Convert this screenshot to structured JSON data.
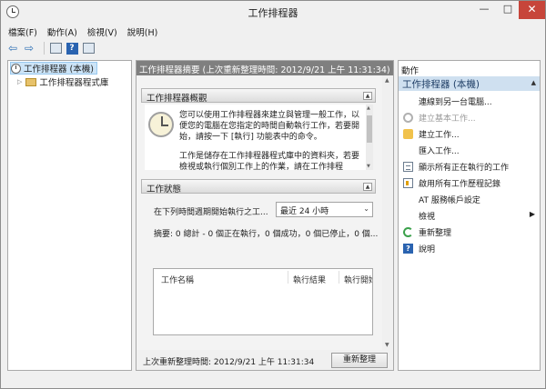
{
  "window": {
    "title": "工作排程器",
    "minimize_glyph": "—",
    "maximize_glyph": "□",
    "close_glyph": "✕"
  },
  "menu": [
    "檔案(F)",
    "動作(A)",
    "檢視(V)",
    "說明(H)"
  ],
  "toolbar": {
    "back_glyph": "⇦",
    "forward_glyph": "⇨",
    "help_glyph": "?"
  },
  "tree": {
    "root_label": "工作排程器 (本機)",
    "child_label": "工作排程器程式庫",
    "expand_glyph": "▷"
  },
  "middle": {
    "header": "工作排程器摘要 (上次重新整理時間: 2012/9/21 上午 11:31:34)",
    "overview": {
      "title": "工作排程器概觀",
      "collapse_glyph": "▲",
      "paragraph1": "您可以使用工作排程器來建立與管理一般工作，以便您的電腦在您指定的時間自動執行工作，若要開始，請按一下 [執行] 功能表中的命令。",
      "paragraph2": "工作是儲存在工作排程器程式庫中的資料夾，若要檢視或執行個別工作上的作業，請在工作排程"
    },
    "status": {
      "title": "工作狀態",
      "collapse_glyph": "▲",
      "period_label": "在下列時間週期開始執行之工...",
      "period_value": "最近 24 小時",
      "summary": "摘要: 0 總計 - 0 個正在執行，0 個成功，0 個已停止，0 個..."
    },
    "table": {
      "columns": [
        "工作名稱",
        "執行結果",
        "執行開始"
      ]
    },
    "footer": {
      "last_refresh": "上次重新整理時間: 2012/9/21 上午 11:31:34",
      "refresh_button": "重新整理"
    }
  },
  "actions": {
    "header": "動作",
    "group_title": "工作排程器 (本機)",
    "group_caret": "▲",
    "items": [
      {
        "label": "連線到另一台電腦...",
        "icon": "blank",
        "enabled": true
      },
      {
        "label": "建立基本工作...",
        "icon": "gear-icon",
        "enabled": false
      },
      {
        "label": "建立工作...",
        "icon": "star-icon",
        "enabled": true
      },
      {
        "label": "匯入工作...",
        "icon": "blank",
        "enabled": true
      },
      {
        "label": "顯示所有正在執行的工作",
        "icon": "list-icon",
        "enabled": true
      },
      {
        "label": "啟用所有工作歷程記錄",
        "icon": "doc-icon",
        "enabled": true
      },
      {
        "label": "AT 服務帳戶設定",
        "icon": "blank",
        "enabled": true
      },
      {
        "label": "檢視",
        "icon": "blank",
        "enabled": true,
        "submenu_glyph": "▶"
      },
      {
        "label": "重新整理",
        "icon": "refresh-icon",
        "enabled": true
      },
      {
        "label": "說明",
        "icon": "help-icon",
        "enabled": true
      }
    ]
  }
}
